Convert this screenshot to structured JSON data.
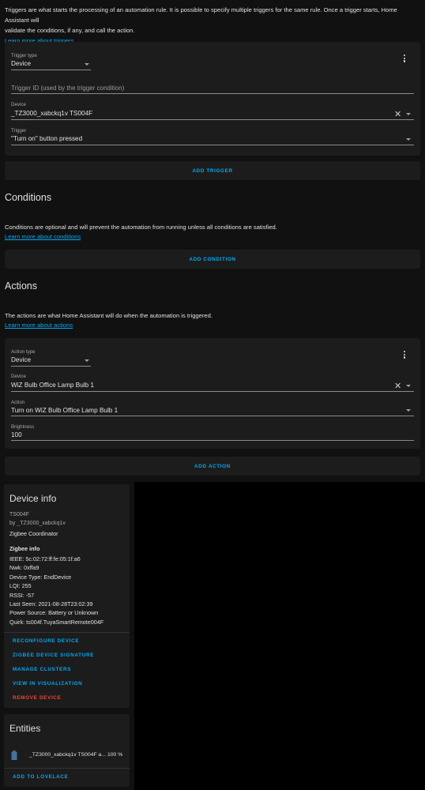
{
  "triggers_intro": {
    "line1": "Triggers are what starts the processing of an automation rule. It is possible to specify multiple triggers for the same rule. Once a trigger starts, Home Assistant will",
    "line2": "validate the conditions, if any, and call the action.",
    "link": "Learn more about triggers"
  },
  "trigger_card": {
    "type_label": "Trigger type",
    "type_value": "Device",
    "id_placeholder": "Trigger ID (used by the trigger condition)",
    "device_label": "Device",
    "device_value": "_TZ3000_xabckq1v TS004F",
    "trigger_label": "Trigger",
    "trigger_value": "\"Turn on\" button pressed"
  },
  "add_trigger": "ADD TRIGGER",
  "conditions": {
    "title": "Conditions",
    "description": "Conditions are optional and will prevent the automation from running unless all conditions are satisfied.",
    "link": "Learn more about conditions",
    "add_button": "ADD CONDITION"
  },
  "actions": {
    "title": "Actions",
    "description": "The actions are what Home Assistant will do when the automation is triggered.",
    "link": "Learn more about actions",
    "add_button": "ADD ACTION"
  },
  "action_card": {
    "type_label": "Action type",
    "type_value": "Device",
    "device_label": "Device",
    "device_value": "WiZ Bulb Office Lamp Bulb 1",
    "action_label": "Action",
    "action_value": "Turn on WiZ Bulb Office Lamp Bulb 1",
    "brightness_label": "Brightness",
    "brightness_value": "100"
  },
  "device_info": {
    "title": "Device info",
    "model": "TS004F",
    "manufacturer": "by _TZ3000_xabckq1v",
    "via": "Zigbee Coordinator",
    "zigbee_title": "Zigbee info",
    "lines": [
      "IEEE: 5c:02:72:ff:fe:05:1f:a6",
      "Nwk: 0xffa9",
      "Device Type: EndDevice",
      "LQI: 255",
      "RSSI: -57",
      "Last Seen: 2021-08-28T23:02:39",
      "Power Source: Battery or Unknown",
      "Quirk: ts004f.TuyaSmartRemote004F"
    ],
    "actions": [
      "RECONFIGURE DEVICE",
      "ZIGBEE DEVICE SIGNATURE",
      "MANAGE CLUSTERS",
      "VIEW IN VISUALIZATION",
      "REMOVE DEVICE"
    ]
  },
  "entities": {
    "title": "Entities",
    "entity_name": "_TZ3000_xabckq1v TS004F a...",
    "entity_value": "100 %",
    "add_to_lovelace": "ADD TO LOVELACE"
  },
  "colors": {
    "accent": "#03a9f4",
    "danger": "#f44336",
    "card": "#1c1c1c",
    "background": "#111111"
  }
}
